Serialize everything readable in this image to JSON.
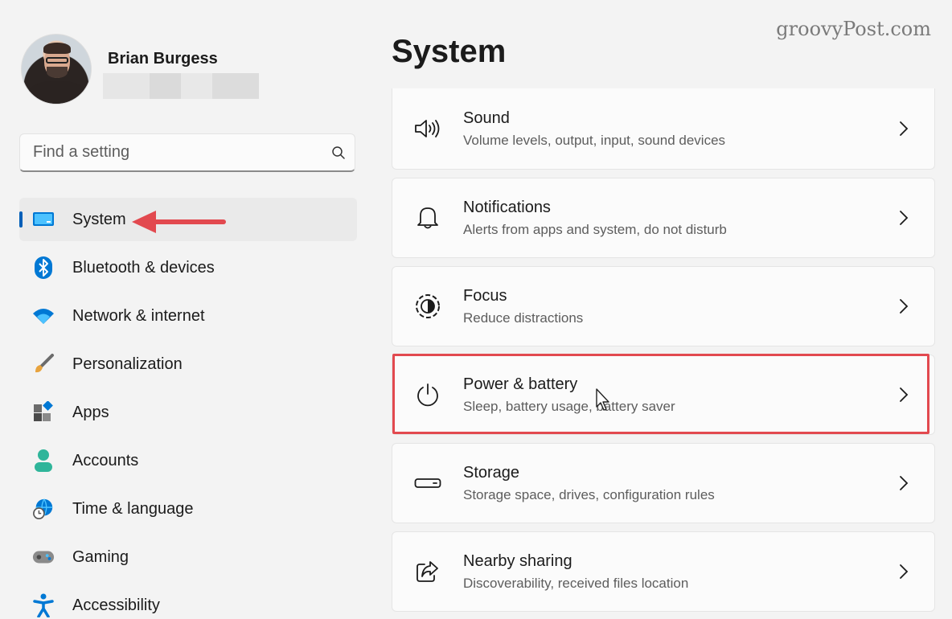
{
  "watermark": "groovyPost.com",
  "profile": {
    "name": "Brian Burgess"
  },
  "search": {
    "placeholder": "Find a setting"
  },
  "nav": {
    "items": [
      {
        "label": "System",
        "icon": "monitor-icon"
      },
      {
        "label": "Bluetooth & devices",
        "icon": "bluetooth-icon"
      },
      {
        "label": "Network & internet",
        "icon": "wifi-icon"
      },
      {
        "label": "Personalization",
        "icon": "brush-icon"
      },
      {
        "label": "Apps",
        "icon": "apps-icon"
      },
      {
        "label": "Accounts",
        "icon": "person-icon"
      },
      {
        "label": "Time & language",
        "icon": "globe-clock-icon"
      },
      {
        "label": "Gaming",
        "icon": "gamepad-icon"
      },
      {
        "label": "Accessibility",
        "icon": "accessibility-icon"
      }
    ]
  },
  "main": {
    "title": "System",
    "cards": [
      {
        "title": "Sound",
        "subtitle": "Volume levels, output, input, sound devices",
        "icon": "speaker-icon"
      },
      {
        "title": "Notifications",
        "subtitle": "Alerts from apps and system, do not disturb",
        "icon": "bell-icon"
      },
      {
        "title": "Focus",
        "subtitle": "Reduce distractions",
        "icon": "focus-icon"
      },
      {
        "title": "Power & battery",
        "subtitle": "Sleep, battery usage, battery saver",
        "icon": "power-icon"
      },
      {
        "title": "Storage",
        "subtitle": "Storage space, drives, configuration rules",
        "icon": "drive-icon"
      },
      {
        "title": "Nearby sharing",
        "subtitle": "Discoverability, received files location",
        "icon": "share-icon"
      }
    ]
  },
  "colors": {
    "accent": "#005fb8",
    "annotation": "#e2494f",
    "background": "#f3f3f3",
    "card": "#fbfbfb"
  }
}
